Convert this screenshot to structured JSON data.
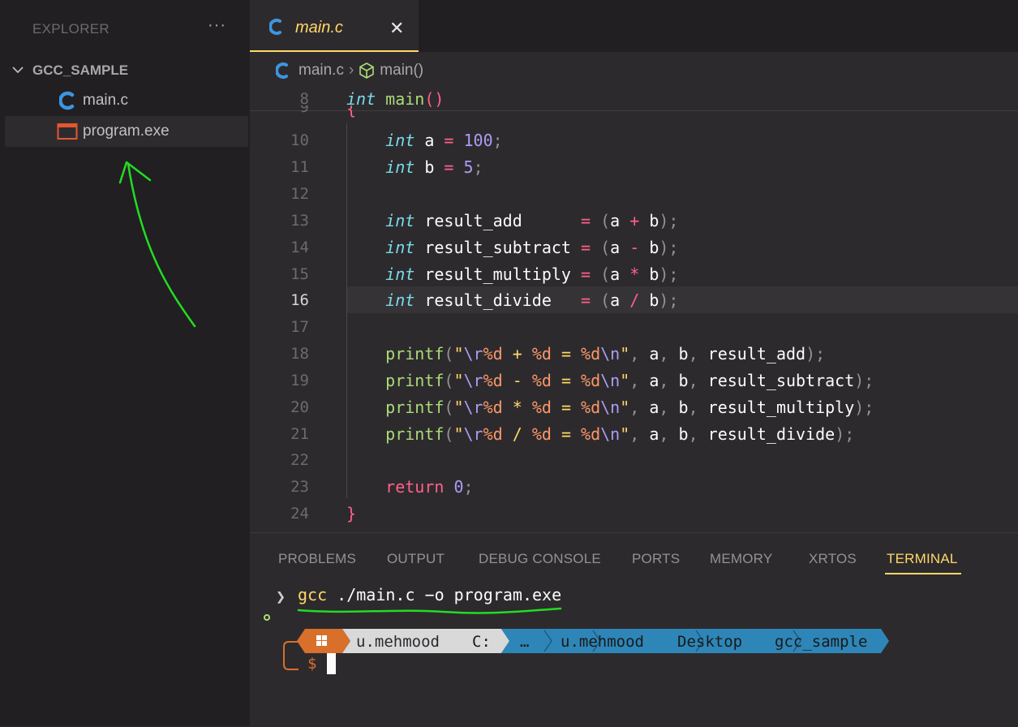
{
  "sidebar": {
    "header": "EXPLORER",
    "more": "···",
    "folder": "GCC_SAMPLE",
    "files": [
      {
        "name": "main.c",
        "icon": "c-file-icon"
      },
      {
        "name": "program.exe",
        "icon": "exe-file-icon"
      }
    ]
  },
  "editor": {
    "tab_label": "main.c",
    "tab_close": "✕",
    "breadcrumb": {
      "file": "main.c",
      "sep": "›",
      "symbol": "main()"
    }
  },
  "code": {
    "lines": [
      {
        "n": "8"
      },
      {
        "n": "9"
      },
      {
        "n": "10"
      },
      {
        "n": "11"
      },
      {
        "n": "12"
      },
      {
        "n": "13"
      },
      {
        "n": "14"
      },
      {
        "n": "15"
      },
      {
        "n": "16"
      },
      {
        "n": "17"
      },
      {
        "n": "18"
      },
      {
        "n": "19"
      },
      {
        "n": "20"
      },
      {
        "n": "21"
      },
      {
        "n": "22"
      },
      {
        "n": "23"
      },
      {
        "n": "24"
      }
    ],
    "current_line": "16"
  },
  "panel": {
    "tabs": [
      "PROBLEMS",
      "OUTPUT",
      "DEBUG CONSOLE",
      "PORTS",
      "MEMORY",
      "XRTOS",
      "TERMINAL"
    ],
    "active_tab": "TERMINAL"
  },
  "terminal": {
    "prompt_symbol": "❯",
    "command_prog": "gcc",
    "command_args": " ./main.c −o program.exe",
    "segments": [
      "u.mehmood",
      "C:",
      "…",
      "u.mehmood",
      "Desktop",
      "gcc_sample"
    ],
    "dollar": "$"
  },
  "colors": {
    "accent": "#ffd866",
    "keyword": "#78dce8",
    "function": "#a9dc76",
    "operator": "#ff6188",
    "number": "#ab9df2",
    "segment_orange": "#d86f2a",
    "segment_grey": "#d9d9d9",
    "segment_blue": "#2e86b8",
    "annotation": "#22dd22"
  }
}
